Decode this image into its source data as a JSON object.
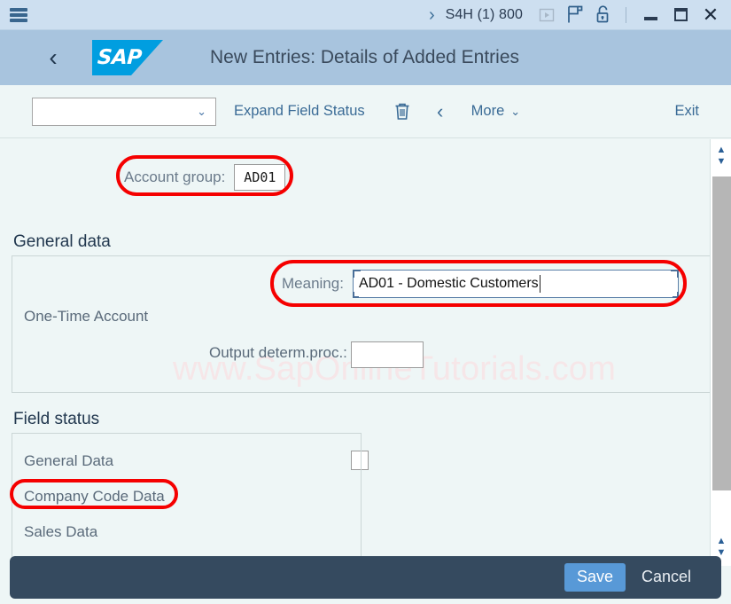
{
  "titlebar": {
    "menu_icon": "hamburger-menu-icon",
    "expand_chevron": "›",
    "system_id": "S4H (1) 800",
    "icons": [
      {
        "name": "play-button-icon",
        "glyph": "▶"
      },
      {
        "name": "new-session-icon",
        "glyph": "P"
      },
      {
        "name": "unlock-icon",
        "glyph": "🔓"
      }
    ],
    "minimize_label": "Minimize",
    "maximize_label": "Maximize",
    "close_label": "✕"
  },
  "shellbar": {
    "back_glyph": "‹",
    "logo_text": "SAP",
    "title": "New Entries: Details of Added Entries"
  },
  "toolbar": {
    "variant_select_value": "",
    "variant_select_caret": "⌄",
    "expand_field_status_label": "Expand Field Status",
    "delete_icon": "trash-icon",
    "back_glyph": "‹",
    "more_label": "More",
    "more_caret": "⌄",
    "exit_label": "Exit"
  },
  "content": {
    "watermark": "www.SapOnlineTutorials.com",
    "account_group": {
      "label": "Account group:",
      "value": "AD01"
    },
    "general_data": {
      "section_title": "General data",
      "meaning": {
        "label": "Meaning:",
        "value": "AD01 - Domestic Customers"
      },
      "one_time_account": {
        "label": "One-Time Account",
        "checked": false
      },
      "output_determ_proc": {
        "label": "Output determ.proc.:",
        "value": ""
      }
    },
    "field_status": {
      "section_title": "Field status",
      "items": [
        {
          "label": "General Data"
        },
        {
          "label": "Company Code Data"
        },
        {
          "label": "Sales Data"
        }
      ]
    }
  },
  "scrollbar": {
    "up_glyph": "▲",
    "down_glyph": "▼"
  },
  "footer": {
    "save_label": "Save",
    "cancel_label": "Cancel"
  },
  "colors": {
    "titlebar_bg": "#cddff0",
    "shellbar_bg": "#a8c4de",
    "content_bg": "#eef6f6",
    "sap_blue": "#009ee0",
    "annotation_red": "#f50000",
    "footer_bg": "#354a5f",
    "save_blue": "#5899d7",
    "link_blue": "#3a6b96"
  }
}
